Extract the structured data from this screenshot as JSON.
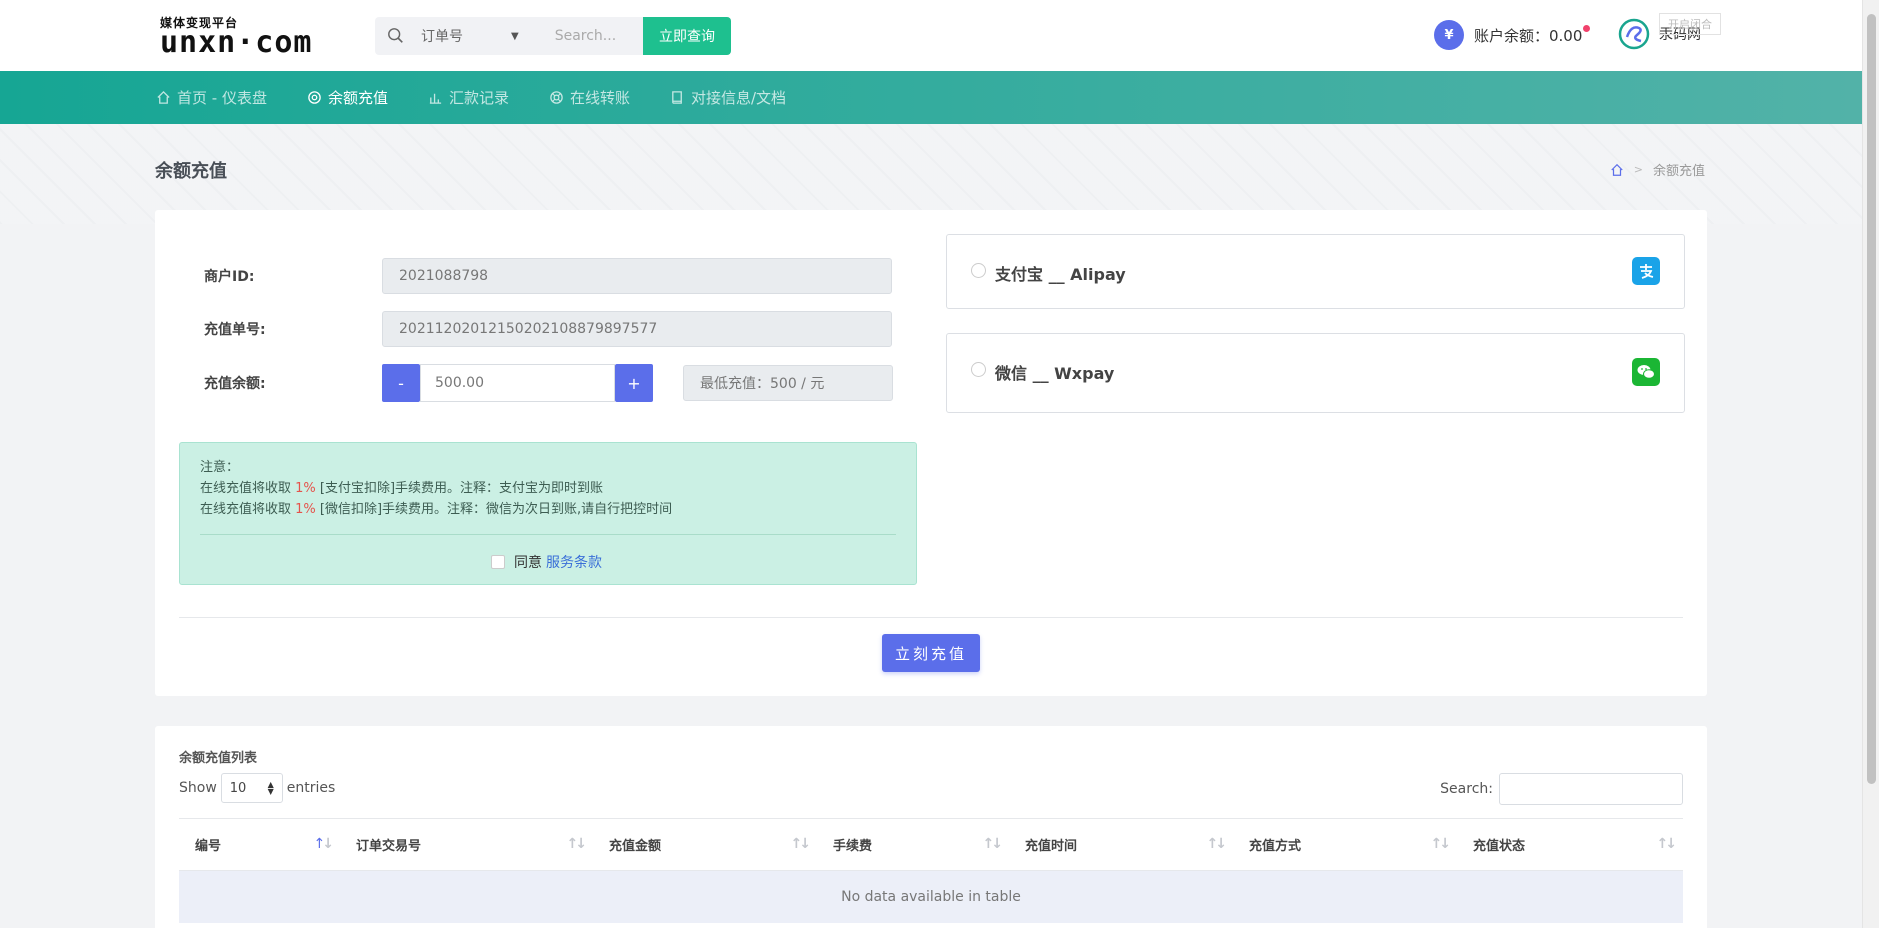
{
  "header": {
    "logo_sub": "媒体变现平台",
    "logo_main": "unxn·com",
    "search_select": "订单号",
    "search_placeholder": "Search...",
    "search_button": "立即查询",
    "balance_label": "账户余额：0.00",
    "site_name": "汞码网",
    "ghost_button": "开启闭合"
  },
  "nav": {
    "items": [
      {
        "label": "首页 - 仪表盘",
        "icon": "home-icon"
      },
      {
        "label": "余额充值",
        "icon": "target-icon"
      },
      {
        "label": "汇款记录",
        "icon": "bar-chart-icon"
      },
      {
        "label": "在线转账",
        "icon": "lifebuoy-icon"
      },
      {
        "label": "对接信息/文档",
        "icon": "book-icon"
      }
    ],
    "active_index": 1
  },
  "page": {
    "title": "余额充值",
    "breadcrumb_current": "余额充值"
  },
  "form": {
    "merchant_label": "商户ID:",
    "merchant_value": "2021088798",
    "order_label": "充值单号:",
    "order_value": "20211202012150202108879897577",
    "amount_label": "充值余额:",
    "minus": "-",
    "amount_value": "500.00",
    "plus": "+",
    "min_recharge": "最低充值：500 / 元"
  },
  "notice": {
    "title": "注意：",
    "line1_prefix": "在线充值将收取 ",
    "line1_pct": "1%",
    "line1_suffix": " [支付宝扣除]手续费用。注释：支付宝为即时到账",
    "line2_prefix": "在线充值将收取 ",
    "line2_pct": "1%",
    "line2_suffix": " [微信扣除]手续费用。注释：微信为次日到账,请自行把控时间",
    "agree_text": "同意",
    "agree_link": "服务条款"
  },
  "payment": [
    {
      "label": "支付宝 __ Alipay",
      "icon": "alipay-icon",
      "color": "#1aa3e8"
    },
    {
      "label": "微信 __ Wxpay",
      "icon": "wechat-icon",
      "color": "#1bb634"
    }
  ],
  "submit_label": "立刻充值",
  "table": {
    "title": "余额充值列表",
    "show_prefix": "Show",
    "page_size": "10",
    "show_suffix": "entries",
    "search_label": "Search:",
    "columns": [
      "编号",
      "订单交易号",
      "充值金额",
      "手续费",
      "充值时间",
      "充值方式",
      "充值状态"
    ],
    "empty": "No data available in table"
  },
  "colors": {
    "primary": "#5b6eea",
    "success": "#1ec08f",
    "nav_start": "#16a694",
    "nav_end": "#52b2a8",
    "notice_bg": "#cbf0e4"
  }
}
